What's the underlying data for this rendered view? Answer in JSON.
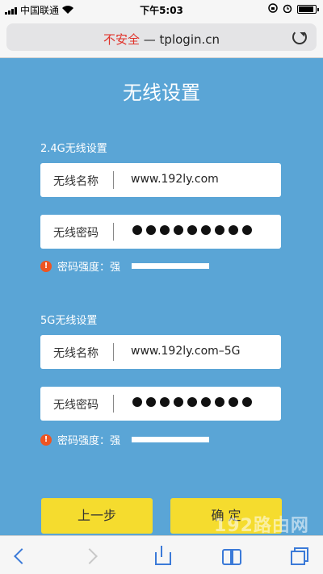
{
  "status_bar": {
    "carrier": "中国联通",
    "time": "下午5:03"
  },
  "browser": {
    "insecure_label": "不安全",
    "separator": " — ",
    "domain": "tplogin.cn"
  },
  "page": {
    "title": "无线设置",
    "band_24": {
      "heading": "2.4G无线设置",
      "name_label": "无线名称",
      "name_value": "www.192ly.com",
      "password_label": "无线密码",
      "strength_label": "密码强度：强"
    },
    "band_5": {
      "heading": "5G无线设置",
      "name_label": "无线名称",
      "name_value": "www.192ly.com–5G",
      "password_label": "无线密码",
      "strength_label": "密码强度：强"
    },
    "prev_button": "上一步",
    "confirm_button": "确 定",
    "watermark": "192路由网"
  },
  "colors": {
    "background": "#5aa5d6",
    "button": "#f5dc2e",
    "insecure": "#e0322a",
    "warning": "#ee5522",
    "ios_blue": "#3b7ad8"
  },
  "icons": [
    "wifi-icon",
    "lock-rotation-icon",
    "alarm-icon",
    "battery-icon",
    "reload-icon",
    "warning-icon",
    "back-icon",
    "forward-icon",
    "share-icon",
    "bookmarks-icon",
    "tabs-icon"
  ]
}
